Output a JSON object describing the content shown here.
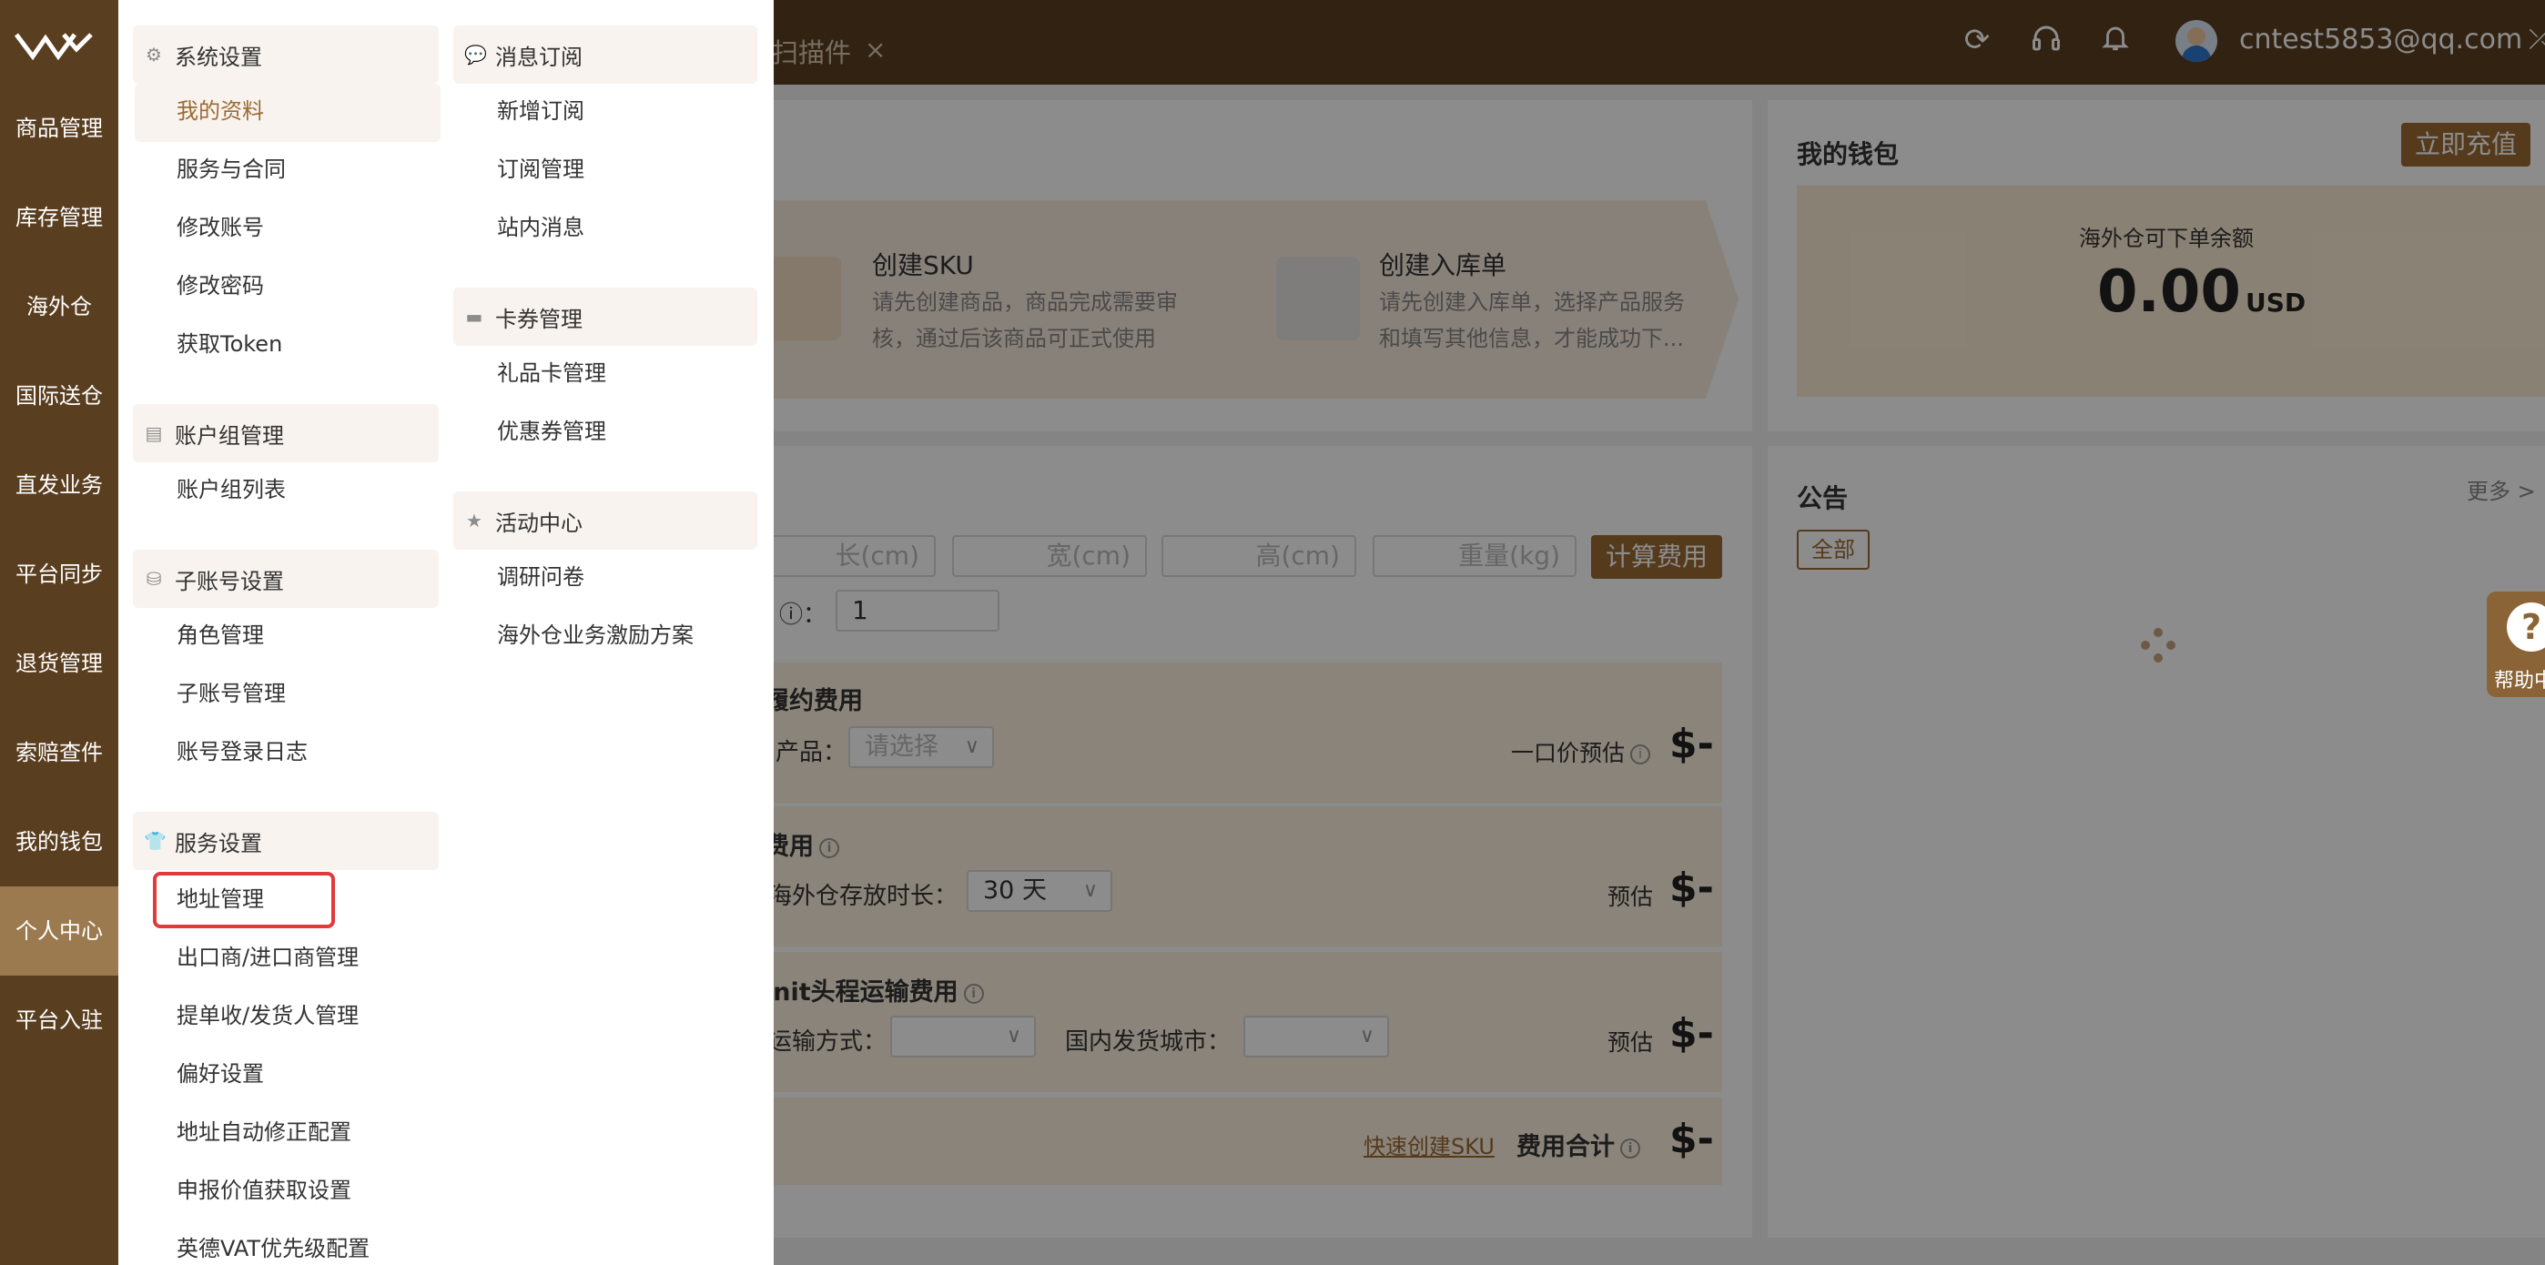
{
  "header": {
    "tab_label": "扫描件",
    "close_glyph": "×",
    "refresh_icon": "refresh-icon",
    "support_icon": "headset-icon",
    "bell_icon": "bell-icon",
    "user_email": "cntest5853@qq.com"
  },
  "sidebar": {
    "items": [
      {
        "label": "商品管理"
      },
      {
        "label": "库存管理"
      },
      {
        "label": "海外仓"
      },
      {
        "label": "国际送仓"
      },
      {
        "label": "直发业务"
      },
      {
        "label": "平台同步"
      },
      {
        "label": "退货管理"
      },
      {
        "label": "索赔查件"
      },
      {
        "label": "我的钱包"
      },
      {
        "label": "个人中心"
      },
      {
        "label": "平台入驻"
      }
    ],
    "active_index": 9
  },
  "steps": [
    {
      "title": "创建SKU",
      "desc1": "请先创建商品，商品完成需要审",
      "desc2": "核，通过后该商品可正式使用"
    },
    {
      "title": "创建入库单",
      "desc1": "请先创建入库单，选择产品服务",
      "desc2": "和填写其他信息，才能成功下..."
    }
  ],
  "wallet": {
    "title": "我的钱包",
    "recharge": "立即充值",
    "balance_label": "海外仓可下单余额",
    "balance": "0.00",
    "currency": "USD"
  },
  "calculator": {
    "length_ph": "长(cm)",
    "width_ph": "宽(cm)",
    "height_ph": "高(cm)",
    "weight_ph": "重量(kg)",
    "calc_btn": "计算费用",
    "qty_label": "ⓘ：",
    "qty_value": "1",
    "fulfill_title": "履约费用",
    "product_label": "产品：",
    "product_placeholder": "请选择",
    "flat_label": "一口价预估",
    "price_dash": "$-",
    "storage_title": "费用",
    "storage_label": "海外仓存放时长：",
    "storage_value": "30 天",
    "estimate": "预估",
    "inbound_title": "init头程运输费用",
    "transport_label": "运输方式：",
    "city_label": "国内发货城市：",
    "quick_link": "快速创建SKU",
    "total_label": "费用合计"
  },
  "notice": {
    "title": "公告",
    "more": "更多",
    "filter_all": "全部"
  },
  "help": {
    "label": "帮助中心"
  },
  "menu": {
    "groups": [
      {
        "label": "系统设置",
        "icon": "gear-icon"
      },
      {
        "label": "账户组管理",
        "icon": "list-icon"
      },
      {
        "label": "子账号设置",
        "icon": "org-chart-icon"
      },
      {
        "label": "服务设置",
        "icon": "shirt-icon"
      },
      {
        "label": "消息订阅",
        "icon": "chat-icon"
      },
      {
        "label": "卡券管理",
        "icon": "card-icon"
      },
      {
        "label": "活动中心",
        "icon": "star-icon"
      }
    ],
    "items": {
      "my_profile": "我的资料",
      "service_contract": "服务与合同",
      "change_account": "修改账号",
      "change_password": "修改密码",
      "get_token": "获取Token",
      "group_list": "账户组列表",
      "role_mgmt": "角色管理",
      "sub_account_mgmt": "子账号管理",
      "login_log": "账号登录日志",
      "address_mgmt": "地址管理",
      "exporter_mgmt": "出口商/进口商管理",
      "consignee_mgmt": "提单收/发货人管理",
      "preferences": "偏好设置",
      "address_autofix": "地址自动修正配置",
      "declared_value": "申报价值获取设置",
      "vat_priority": "英德VAT优先级配置",
      "new_subscription": "新增订阅",
      "subscription_mgmt": "订阅管理",
      "inbox": "站内消息",
      "gift_card": "礼品卡管理",
      "coupon": "优惠券管理",
      "survey": "调研问卷",
      "incentive": "海外仓业务激励方案"
    }
  }
}
